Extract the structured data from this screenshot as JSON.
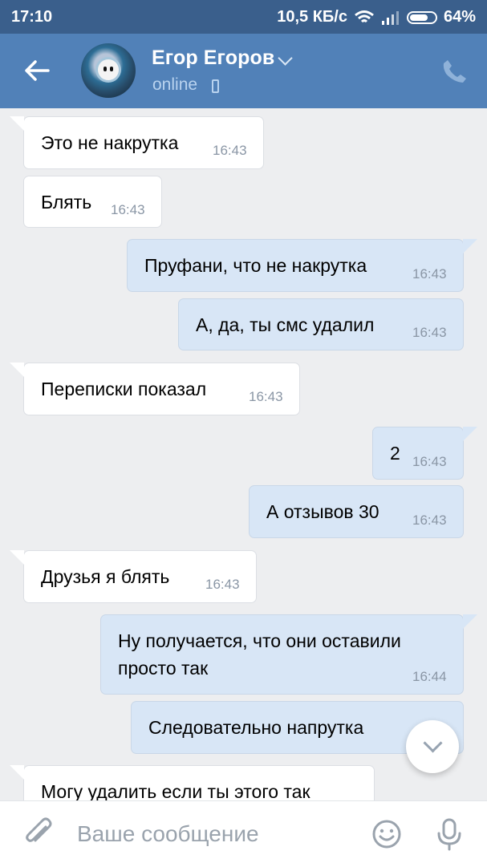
{
  "status_bar": {
    "time": "17:10",
    "speed": "10,5 КБ/с",
    "battery": "64%"
  },
  "header": {
    "contact_name": "Егор Егоров",
    "presence": "online"
  },
  "messages": [
    {
      "text": "Это не накрутка",
      "time": "16:43",
      "direction": "in"
    },
    {
      "text": "Блять",
      "time": "16:43",
      "direction": "in"
    },
    {
      "text": "Пруфани, что не накрутка",
      "time": "16:43",
      "direction": "out"
    },
    {
      "text": "А, да, ты смс удалил",
      "time": "16:43",
      "direction": "out"
    },
    {
      "text": "Переписки показал",
      "time": "16:43",
      "direction": "in"
    },
    {
      "text": "2",
      "time": "16:43",
      "direction": "out"
    },
    {
      "text": "А отзывов 30",
      "time": "16:43",
      "direction": "out"
    },
    {
      "text": "Друзья я блять",
      "time": "16:43",
      "direction": "in"
    },
    {
      "line1": "Ну получается, что они оставили",
      "line2": "просто так",
      "time": "16:44",
      "direction": "out"
    },
    {
      "text": "Следовательно напрутка",
      "direction": "out"
    },
    {
      "text": "Могу удалить если ты этого так",
      "direction": "in"
    }
  ],
  "composer": {
    "placeholder": "Ваше сообщение"
  },
  "colors": {
    "header": "#5181b8",
    "status_bar": "#3a5f8c",
    "background": "#edeef0",
    "outgoing_bubble": "#d8e6f6",
    "incoming_bubble": "#ffffff"
  },
  "icons": [
    "back-arrow-icon",
    "chevron-down-icon",
    "mobile-phone-icon",
    "phone-call-icon",
    "paperclip-icon",
    "emoji-icon",
    "microphone-icon",
    "scroll-down-icon",
    "wifi-icon",
    "signal-icon",
    "battery-icon"
  ]
}
